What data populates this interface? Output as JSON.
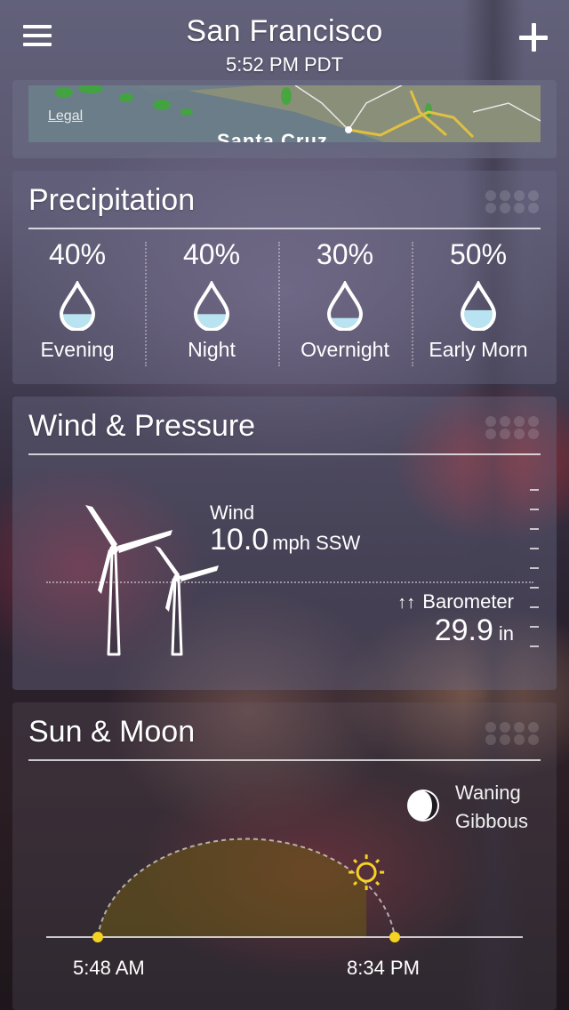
{
  "header": {
    "city": "San Francisco",
    "time": "5:52 PM PDT"
  },
  "map": {
    "legal_label": "Legal",
    "place_label": "Santa Cruz"
  },
  "precipitation": {
    "title": "Precipitation",
    "periods": [
      {
        "percent": "40%",
        "label": "Evening",
        "fill": 0.4
      },
      {
        "percent": "40%",
        "label": "Night",
        "fill": 0.4
      },
      {
        "percent": "30%",
        "label": "Overnight",
        "fill": 0.3
      },
      {
        "percent": "50%",
        "label": "Early Morn",
        "fill": 0.5
      }
    ]
  },
  "wind_pressure": {
    "title": "Wind & Pressure",
    "wind_label": "Wind",
    "wind_value": "10.0",
    "wind_unit": "mph SSW",
    "barometer_arrows": "↑↑",
    "barometer_label": "Barometer",
    "barometer_value": "29.9",
    "barometer_unit": "in"
  },
  "sun_moon": {
    "title": "Sun & Moon",
    "moon_phase": [
      "Waning",
      "Gibbous"
    ],
    "sunrise": "5:48 AM",
    "sunset": "8:34 PM",
    "day_progress": 0.8
  },
  "colors": {
    "accent_yellow": "#f5d322",
    "water": "#b9e3f0"
  },
  "icons": [
    "menu-icon",
    "add-icon",
    "drop-icon",
    "wind-turbine-icon",
    "moon-icon",
    "sun-icon"
  ]
}
